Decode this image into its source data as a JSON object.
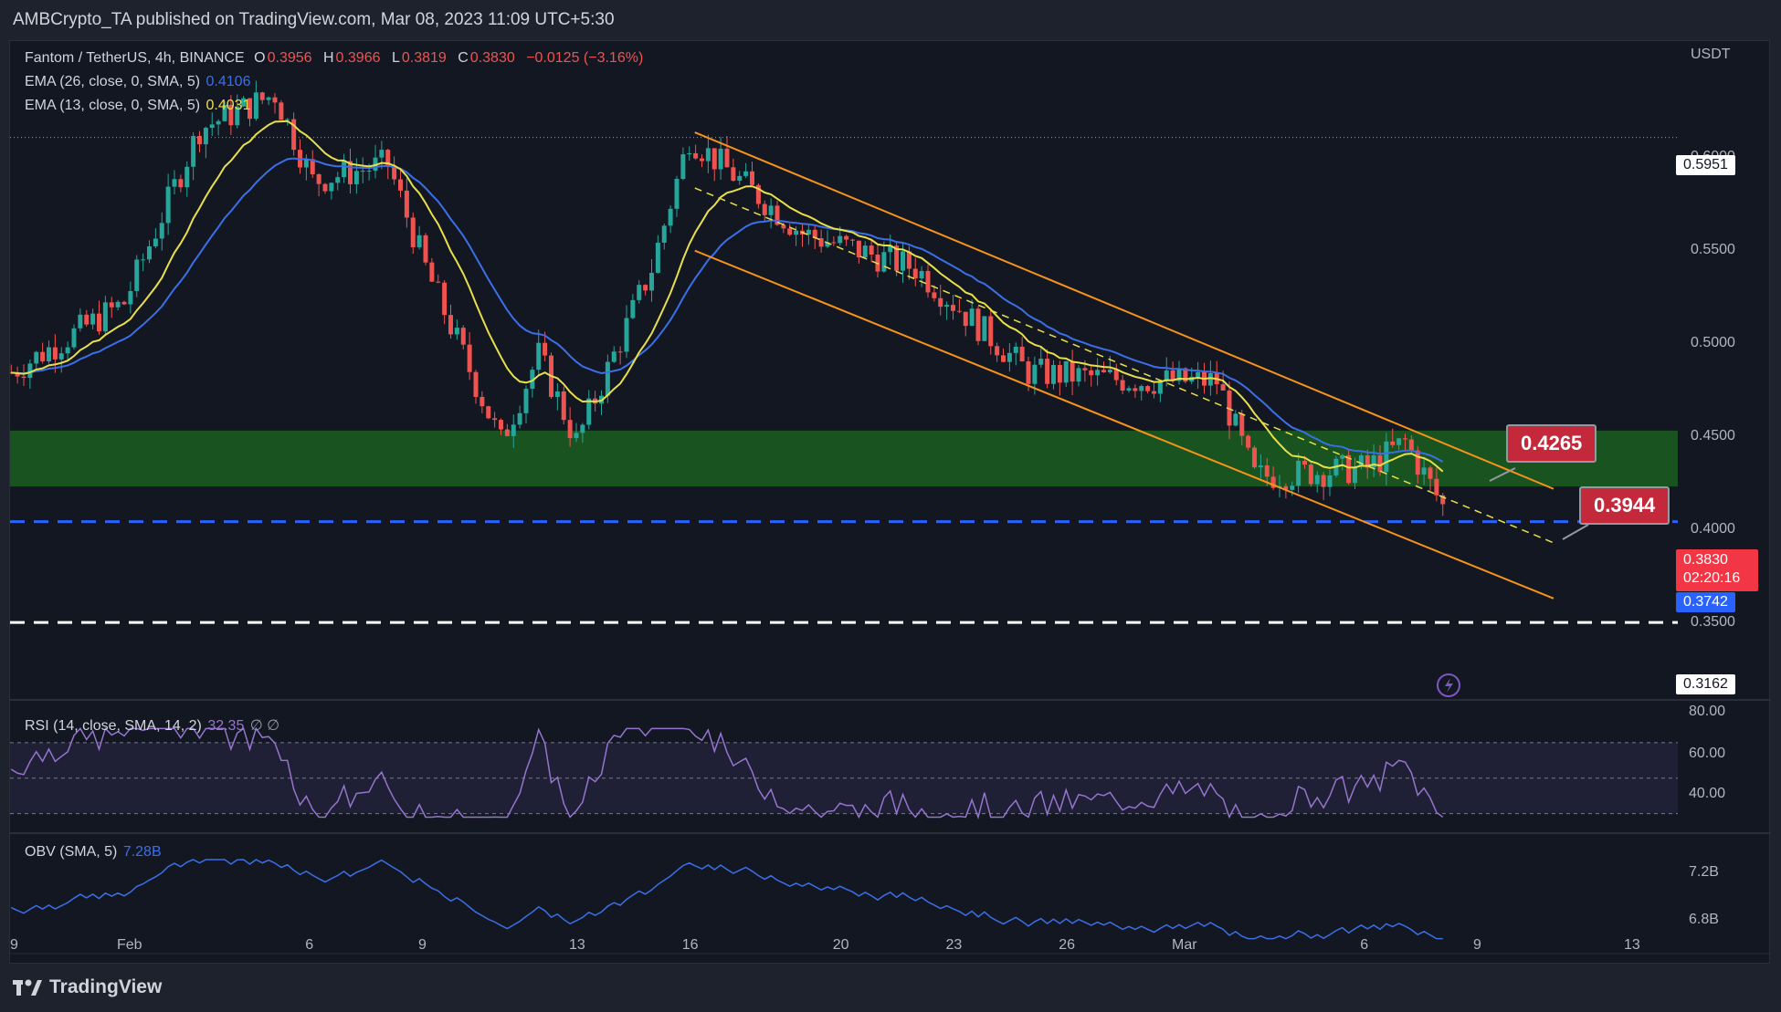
{
  "header": {
    "publisher_line": "AMBCrypto_TA published on TradingView.com, Mar 08, 2023 11:09 UTC+5:30"
  },
  "symbol": {
    "title": "Fantom / TetherUS, 4h, BINANCE",
    "open_label": "O",
    "open": "0.3956",
    "high_label": "H",
    "high": "0.3966",
    "low_label": "L",
    "low": "0.3819",
    "close_label": "C",
    "close": "0.3830",
    "change": "−0.0125 (−3.16%)"
  },
  "ema26": {
    "label": "EMA (26, close, 0, SMA, 5)",
    "value": "0.4106",
    "color": "#3b6fe8"
  },
  "ema13": {
    "label": "EMA (13, close, 0, SMA, 5)",
    "value": "0.4031",
    "color": "#e8e04a"
  },
  "price_axis": {
    "currency": "USDT",
    "ticks": [
      "0.5500",
      "0.5000",
      "0.4500",
      "0.4000",
      "0.3500"
    ],
    "partial_top_tick": "0.6000"
  },
  "price_labels": {
    "resistance_top": "0.5951",
    "current_price": "0.3830",
    "countdown": "02:20:16",
    "blue_level": "0.3742",
    "white_level": "0.3162"
  },
  "callouts": {
    "upper": "0.4265",
    "lower": "0.3944"
  },
  "rsi": {
    "label": "RSI (14, close, SMA, 14, 2)",
    "value": "32.35",
    "extra": "∅ ∅",
    "ticks": [
      "80.00",
      "60.00",
      "40.00"
    ]
  },
  "obv": {
    "label": "OBV (SMA, 5)",
    "value": "7.28B",
    "ticks": [
      "7.2B",
      "6.8B"
    ]
  },
  "time_axis": {
    "labels": [
      "9",
      "Feb",
      "6",
      "9",
      "13",
      "16",
      "20",
      "23",
      "26",
      "Mar",
      "6",
      "9",
      "13"
    ]
  },
  "footer": {
    "brand": "TradingView"
  },
  "colors": {
    "background": "#131722",
    "up": "#26a69a",
    "down": "#ef5350",
    "channel": "#f7931a",
    "support_zone": "#1b5e20",
    "blue_dash": "#2962ff",
    "rsi_line": "#9575cd",
    "obv_line": "#3b6fe8",
    "callout": "#c3283b"
  },
  "chart_data": {
    "type": "candlestick",
    "title": "Fantom / TetherUS, 4h, BINANCE",
    "y_unit": "USDT",
    "ylim": [
      0.3,
      0.64
    ],
    "x_labels": [
      "9",
      "Feb",
      "6",
      "9",
      "13",
      "16",
      "20",
      "23",
      "26",
      "Mar",
      "6",
      "9",
      "13"
    ],
    "key_closes": [
      {
        "x": "Jan 29",
        "y": 0.46
      },
      {
        "x": "Feb 1",
        "y": 0.5
      },
      {
        "x": "Feb 3",
        "y": 0.6
      },
      {
        "x": "Feb 5",
        "y": 0.62
      },
      {
        "x": "Feb 6",
        "y": 0.57
      },
      {
        "x": "Feb 8",
        "y": 0.58
      },
      {
        "x": "Feb 9",
        "y": 0.52
      },
      {
        "x": "Feb 11",
        "y": 0.42
      },
      {
        "x": "Feb 12",
        "y": 0.47
      },
      {
        "x": "Feb 13",
        "y": 0.42
      },
      {
        "x": "Feb 15",
        "y": 0.52
      },
      {
        "x": "Feb 16",
        "y": 0.595
      },
      {
        "x": "Feb 19",
        "y": 0.54
      },
      {
        "x": "Feb 22",
        "y": 0.52
      },
      {
        "x": "Feb 25",
        "y": 0.46
      },
      {
        "x": "Feb 28",
        "y": 0.455
      },
      {
        "x": "Mar 2",
        "y": 0.455
      },
      {
        "x": "Mar 3",
        "y": 0.4
      },
      {
        "x": "Mar 6",
        "y": 0.405
      },
      {
        "x": "Mar 7",
        "y": 0.42
      },
      {
        "x": "Mar 8",
        "y": 0.383
      }
    ],
    "horizontal_levels": [
      {
        "label": "0.5951",
        "value": 0.5951,
        "style": "dotted"
      },
      {
        "label": "0.3742",
        "value": 0.3742,
        "style": "dashed",
        "color": "#2962ff"
      },
      {
        "label": "0.3162",
        "value": 0.3162,
        "style": "dashed",
        "color": "#ffffff"
      }
    ],
    "support_zone": {
      "from": 0.3944,
      "to": 0.4265
    },
    "descending_channel": true,
    "indicators": {
      "ema_26": 0.4106,
      "ema_13": 0.4031,
      "rsi": 32.35,
      "rsi_ticks": [
        80,
        60,
        40
      ],
      "obv": "7.28B"
    }
  }
}
